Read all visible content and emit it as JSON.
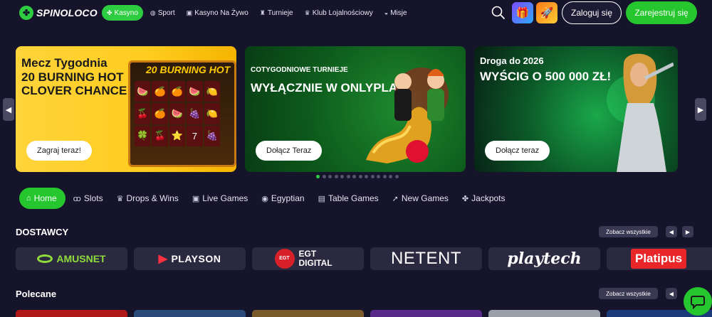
{
  "header": {
    "logo_text": "SPINOLOCO",
    "nav": [
      {
        "label": "Kasyno",
        "icon": "clover-icon",
        "glyph": "✤",
        "active": true
      },
      {
        "label": "Sport",
        "icon": "ball-icon",
        "glyph": "◍",
        "active": false
      },
      {
        "label": "Kasyno Na Żywo",
        "icon": "cards-icon",
        "glyph": "▣",
        "active": false
      },
      {
        "label": "Turnieje",
        "icon": "tournament-icon",
        "glyph": "♜",
        "active": false
      },
      {
        "label": "Klub Lojalnościowy",
        "icon": "crown-icon",
        "glyph": "♛",
        "active": false
      },
      {
        "label": "Misje",
        "icon": "mission-icon",
        "glyph": "◒",
        "active": false
      }
    ],
    "login_label": "Zaloguj się",
    "register_label": "Zarejestruj się"
  },
  "banners": [
    {
      "title": "Mecz Tygodnia",
      "headline": "20 BURNING HOT CLOVER CHANCE",
      "button": "Zagraj teraz!",
      "slot_title": "20 BURNING HOT"
    },
    {
      "title": "COTYGODNIOWE TURNIEJE",
      "headline": "WYŁĄCZNIE W ONLYPLAY",
      "button": "Dołącz Teraz"
    },
    {
      "title": "Droga do 2026",
      "headline": "WYŚCIG O 500 000 ZŁ!",
      "button": "Dołącz teraz"
    }
  ],
  "carousel": {
    "dot_count": 14,
    "active_index": 0
  },
  "categories": [
    {
      "label": "Home",
      "icon": "home-icon",
      "glyph": "⌂",
      "active": true
    },
    {
      "label": "Slots",
      "icon": "cherries-icon",
      "glyph": "ꝏ",
      "active": false
    },
    {
      "label": "Drops & Wins",
      "icon": "crown-icon",
      "glyph": "♛",
      "active": false
    },
    {
      "label": "Live Games",
      "icon": "cards-icon",
      "glyph": "▣",
      "active": false
    },
    {
      "label": "Egyptian",
      "icon": "eye-icon",
      "glyph": "◉",
      "active": false
    },
    {
      "label": "Table Games",
      "icon": "table-icon",
      "glyph": "▤",
      "active": false
    },
    {
      "label": "New Games",
      "icon": "rocket-icon",
      "glyph": "➚",
      "active": false
    },
    {
      "label": "Jackpots",
      "icon": "clover-icon",
      "glyph": "✤",
      "active": false
    }
  ],
  "providers_section": {
    "title": "DOSTAWCY",
    "see_all": "Zobacz wszystkie",
    "providers": [
      "AMUSNET",
      "PLAYSON",
      "EGT DIGITAL",
      "NETENT",
      "playtech",
      "Platipus"
    ]
  },
  "featured_section": {
    "title": "Polecane",
    "see_all": "Zobacz wszystkie"
  },
  "colors": {
    "accent": "#26c62e",
    "background": "#16142a",
    "card": "#2b2940"
  }
}
